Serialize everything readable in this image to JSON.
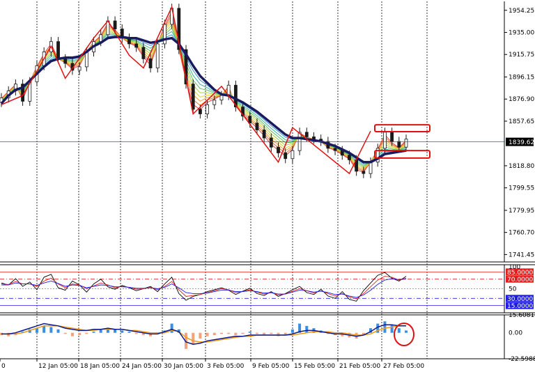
{
  "chart_data": [
    {
      "type": "candlestick",
      "panel": "price",
      "y_ticks": [
        "1954.25",
        "1935.00",
        "1915.75",
        "1896.15",
        "1876.90",
        "1857.65",
        "1818.80",
        "1799.55",
        "1779.95",
        "1760.70",
        "1741.45"
      ],
      "ylim": [
        1735,
        1962
      ],
      "current_price": 1839.62,
      "current_price_label": "1839.62",
      "x_ticks": [
        "0",
        "12 Jan 05:00",
        "18 Jan 05:00",
        "24 Jan 05:00",
        "30 Jan 05:00",
        "3 Feb 05:00",
        "9 Feb 05:00",
        "15 Feb 05:00",
        "21 Feb 05:00",
        "27 Feb 05:00"
      ],
      "closes": [
        1878,
        1884,
        1890,
        1875,
        1892,
        1906,
        1918,
        1927,
        1912,
        1908,
        1902,
        1905,
        1918,
        1927,
        1933,
        1945,
        1938,
        1930,
        1925,
        1922,
        1912,
        1904,
        1925,
        1942,
        1956,
        1920,
        1890,
        1868,
        1864,
        1872,
        1876,
        1880,
        1889,
        1870,
        1862,
        1856,
        1850,
        1843,
        1835,
        1830,
        1825,
        1832,
        1848,
        1844,
        1842,
        1840,
        1834,
        1832,
        1828,
        1824,
        1814,
        1812,
        1822,
        1834,
        1848,
        1840,
        1835,
        1842
      ],
      "zigzag": [
        [
          0,
          1872
        ],
        [
          3,
          1880
        ],
        [
          6,
          1912
        ],
        [
          7,
          1923
        ],
        [
          9,
          1895
        ],
        [
          13,
          1930
        ],
        [
          15,
          1945
        ],
        [
          18,
          1915
        ],
        [
          20,
          1904
        ],
        [
          24,
          1957
        ],
        [
          27,
          1864
        ],
        [
          31,
          1888
        ],
        [
          39,
          1822
        ],
        [
          41,
          1852
        ],
        [
          49,
          1812
        ],
        [
          52,
          1849
        ]
      ],
      "boxes": [
        {
          "from": 1848.5,
          "to": 1854.5,
          "label": ""
        },
        {
          "from": 1825.5,
          "to": 1832,
          "label": ""
        }
      ],
      "moving_average": [
        1873,
        1880,
        1885,
        1887,
        1893,
        1899,
        1905,
        1910,
        1912,
        1913,
        1913,
        1914,
        1918,
        1923,
        1926,
        1930,
        1931,
        1931,
        1930,
        1930,
        1928,
        1926,
        1927,
        1929,
        1930,
        1925,
        1916,
        1906,
        1897,
        1891,
        1885,
        1881,
        1880,
        1877,
        1874,
        1870,
        1866,
        1861,
        1856,
        1851,
        1846,
        1843,
        1843,
        1842,
        1841,
        1840,
        1838,
        1836,
        1833,
        1830,
        1826,
        1822,
        1822,
        1825,
        1829,
        1830,
        1831,
        1832
      ]
    },
    {
      "type": "line",
      "panel": "oscillator",
      "levels": [
        {
          "value": 85,
          "label": "85.0000",
          "color": "#e02020"
        },
        {
          "value": 70,
          "label": "70.0000",
          "color": "#e02020"
        },
        {
          "value": 50,
          "label": "50",
          "color": "#808080"
        },
        {
          "value": 30,
          "label": "30.0000",
          "color": "#2020e0"
        },
        {
          "value": 15,
          "label": "15.0000",
          "color": "#2020e0"
        }
      ],
      "top_label": "100",
      "ylim": [
        0,
        100
      ],
      "series": [
        {
          "color": "#000000",
          "values": [
            62,
            58,
            71,
            55,
            64,
            48,
            74,
            80,
            52,
            47,
            66,
            58,
            43,
            60,
            70,
            54,
            49,
            57,
            52,
            46,
            50,
            55,
            44,
            60,
            74,
            40,
            26,
            34,
            38,
            44,
            48,
            52,
            47,
            38,
            45,
            51,
            40,
            36,
            44,
            34,
            40,
            48,
            55,
            42,
            38,
            49,
            35,
            30,
            44,
            28,
            24,
            46,
            62,
            78,
            84,
            72,
            66,
            76
          ]
        },
        {
          "color": "#e02020",
          "values": [
            60,
            59,
            65,
            60,
            60,
            55,
            66,
            72,
            60,
            52,
            60,
            58,
            50,
            56,
            62,
            58,
            52,
            55,
            53,
            49,
            50,
            53,
            48,
            55,
            65,
            48,
            34,
            36,
            38,
            42,
            46,
            50,
            48,
            42,
            44,
            48,
            43,
            39,
            42,
            37,
            39,
            45,
            50,
            46,
            41,
            46,
            40,
            35,
            40,
            33,
            29,
            40,
            54,
            68,
            76,
            74,
            68,
            72
          ]
        },
        {
          "color": "#2020e0",
          "values": [
            58,
            58,
            62,
            60,
            60,
            57,
            62,
            66,
            61,
            55,
            58,
            57,
            52,
            55,
            58,
            57,
            54,
            54,
            53,
            51,
            51,
            52,
            50,
            53,
            60,
            52,
            42,
            40,
            40,
            41,
            44,
            47,
            47,
            44,
            44,
            46,
            44,
            41,
            42,
            39,
            39,
            43,
            47,
            46,
            43,
            45,
            42,
            38,
            39,
            35,
            32,
            37,
            47,
            59,
            68,
            71,
            69,
            70
          ]
        }
      ]
    },
    {
      "type": "bar",
      "panel": "macd",
      "y_ticks": [
        "15.6081",
        "0.00",
        "-22.5988"
      ],
      "ylim": [
        -22.5988,
        15.6081
      ],
      "histogram": [
        -2,
        -3,
        -2,
        1,
        3,
        4,
        6,
        5,
        3,
        -1,
        -3,
        -2,
        -1,
        1,
        3,
        4,
        3,
        2,
        1,
        -1,
        -2,
        -3,
        -1,
        2,
        8,
        3,
        -14,
        -10,
        -5,
        -3,
        -2,
        -1,
        -1,
        -2,
        -1,
        1,
        -1,
        -2,
        -1,
        -3,
        -2,
        3,
        8,
        6,
        4,
        2,
        -1,
        -2,
        -3,
        -4,
        -5,
        -2,
        4,
        8,
        10,
        7,
        4,
        2
      ],
      "main_line": [
        -1,
        -1,
        0,
        2,
        4,
        6,
        8,
        7,
        6,
        4,
        3,
        2,
        2,
        3,
        3,
        4,
        3,
        3,
        2,
        1,
        0,
        -1,
        -1,
        1,
        3,
        1,
        -8,
        -10,
        -9,
        -7,
        -6,
        -5,
        -4,
        -3,
        -3,
        -2,
        -2,
        -2,
        -2,
        -2,
        -2,
        -1,
        1,
        2,
        2,
        1,
        0,
        -1,
        -1,
        -2,
        -3,
        -2,
        1,
        5,
        7,
        7,
        6,
        6
      ],
      "signal_line": [
        -1,
        -1,
        -1,
        0,
        2,
        4,
        6,
        6,
        6,
        5,
        4,
        3,
        2,
        2,
        3,
        3,
        3,
        3,
        2,
        2,
        1,
        0,
        0,
        0,
        2,
        1,
        -4,
        -7,
        -8,
        -8,
        -7,
        -6,
        -5,
        -4,
        -3,
        -3,
        -2,
        -2,
        -2,
        -2,
        -2,
        -2,
        -1,
        0,
        1,
        1,
        1,
        0,
        0,
        -1,
        -2,
        -2,
        -1,
        2,
        4,
        5,
        6,
        6
      ],
      "histogram_positive_color": "#3b8fe0",
      "histogram_negative_color": "#f4a27a",
      "main_color": "#0a1a8c",
      "signal_color": "#f09a1a"
    }
  ],
  "colors": {
    "candle": "#1a1a1a",
    "zigzag": "#e01010",
    "ma_thick": "#1a1a5e",
    "price_line": "#3050e0",
    "box": "#e01010",
    "grid": "#000000",
    "price_tag_bg": "#000000"
  }
}
